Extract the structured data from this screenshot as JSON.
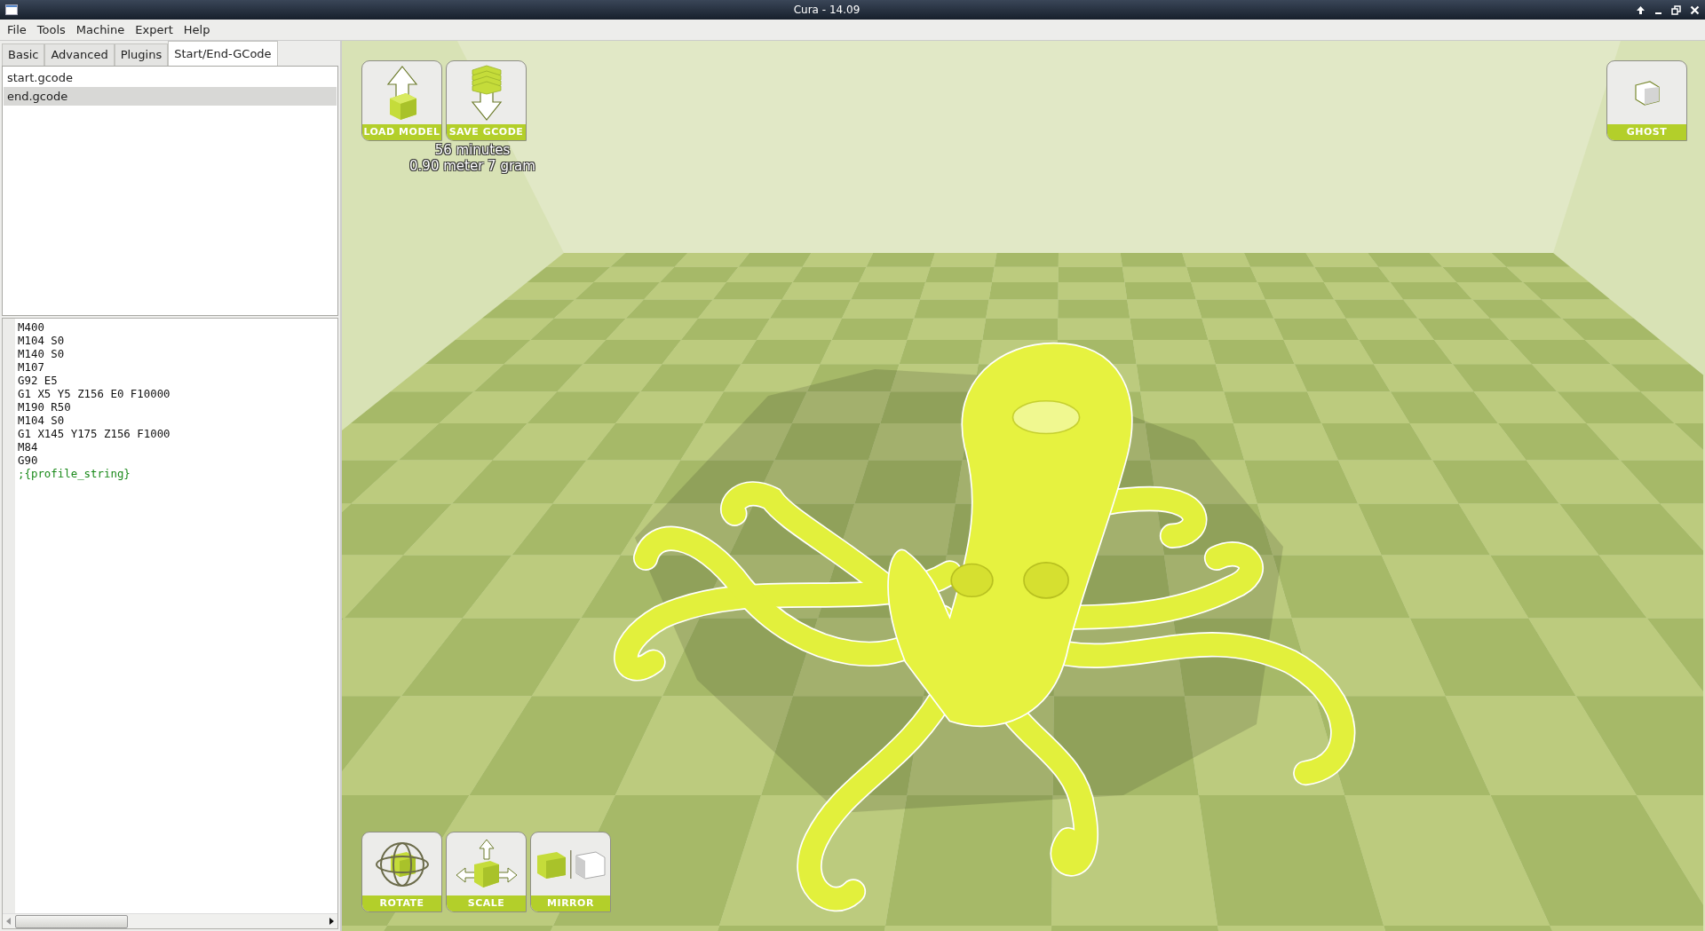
{
  "window": {
    "title": "Cura - 14.09"
  },
  "menu": [
    "File",
    "Tools",
    "Machine",
    "Expert",
    "Help"
  ],
  "tabs": [
    {
      "label": "Basic",
      "selected": false
    },
    {
      "label": "Advanced",
      "selected": false
    },
    {
      "label": "Plugins",
      "selected": false
    },
    {
      "label": "Start/End-GCode",
      "selected": true
    }
  ],
  "gcode_files": [
    {
      "name": "start.gcode",
      "selected": false
    },
    {
      "name": "end.gcode",
      "selected": true
    }
  ],
  "gcode_lines": [
    {
      "text": "M400",
      "kind": "code"
    },
    {
      "text": "M104 S0",
      "kind": "code"
    },
    {
      "text": "M140 S0",
      "kind": "code"
    },
    {
      "text": "M107",
      "kind": "code"
    },
    {
      "text": "G92 E5",
      "kind": "code"
    },
    {
      "text": "G1 X5 Y5 Z156 E0 F10000",
      "kind": "code"
    },
    {
      "text": "M190 R50",
      "kind": "code"
    },
    {
      "text": "M104 S0",
      "kind": "code"
    },
    {
      "text": "G1 X145 Y175 Z156 F1000",
      "kind": "code"
    },
    {
      "text": "M84",
      "kind": "code"
    },
    {
      "text": "G90",
      "kind": "code"
    },
    {
      "text": ";{profile_string}",
      "kind": "comment"
    }
  ],
  "top_buttons": [
    {
      "label": "LOAD MODEL",
      "kind": "load"
    },
    {
      "label": "SAVE GCODE",
      "kind": "save"
    }
  ],
  "print_info": [
    "56 minutes",
    "0.90 meter 7 gram"
  ],
  "view_button": {
    "label": "GHOST",
    "kind": "ghost"
  },
  "tool_buttons": [
    {
      "label": "ROTATE",
      "kind": "rotate"
    },
    {
      "label": "SCALE",
      "kind": "scale"
    },
    {
      "label": "MIRROR",
      "kind": "mirror"
    }
  ]
}
